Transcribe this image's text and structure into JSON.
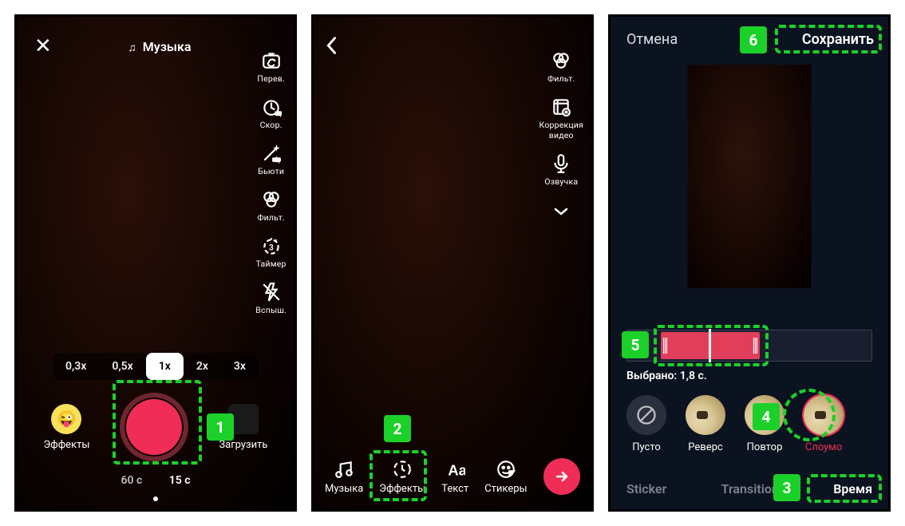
{
  "screen1": {
    "music_label": "Музыка",
    "tools": {
      "flip": "Перев.",
      "speed": "Скор.",
      "beauty": "Бьюти",
      "filters": "Фильт.",
      "timer": "Таймер",
      "flash": "Вспыш."
    },
    "speeds": [
      "0,3x",
      "0,5x",
      "1x",
      "2x",
      "3x"
    ],
    "effects_label": "Эффекты",
    "upload_label": "Загрузить",
    "durations": {
      "secondary": "60 c",
      "primary": "15 c"
    }
  },
  "screen2": {
    "tools": {
      "filters": "Фильт.",
      "correction": "Коррекция\nвидео",
      "voiceover": "Озвучка"
    },
    "edit_tools": {
      "music": "Музыка",
      "effects": "Эффекты",
      "text": "Текст",
      "stickers": "Стикеры"
    }
  },
  "screen3": {
    "cancel": "Отмена",
    "save": "Сохранить",
    "selected_label": "Выбрано: 1,8 с.",
    "effects": {
      "none": "Пусто",
      "reverse": "Реверс",
      "repeat": "Повтор",
      "slowmo": "Слоумо"
    },
    "tabs": {
      "sticker": "Sticker",
      "transition": "Transition",
      "time": "Время"
    }
  },
  "markers": {
    "m1": "1",
    "m2": "2",
    "m3": "3",
    "m4": "4",
    "m5": "5",
    "m6": "6"
  }
}
